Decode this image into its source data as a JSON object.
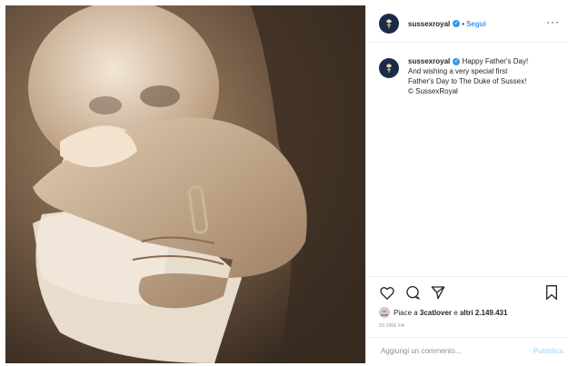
{
  "post": {
    "username": "sussexroyal",
    "follow_label": "Segui",
    "separator": "•",
    "more_icon": "more-dots-icon",
    "caption": {
      "username": "sussexroyal",
      "line1": "Happy Father's Day!",
      "line2": "And wishing a very special first",
      "line3": "Father's Day to The Duke of Sussex!",
      "line4": "© SussexRoyal"
    },
    "actions": {
      "icons": [
        "heart-icon",
        "comment-icon",
        "share-icon",
        "bookmark-icon"
      ]
    },
    "likes": {
      "prefix": "Piace a ",
      "user": "3catlover",
      "middle": " e ",
      "others": "altri 2.149.431",
      "avatar_text": "I ♥ CATS"
    },
    "time": "20 ORE FA",
    "comment": {
      "placeholder": "Aggiungi un commento...",
      "publish_label": "Pubblica"
    }
  },
  "colors": {
    "accent": "#3897f0",
    "avatar_bg": "#1d2b4a",
    "photo_tone": "#8a6e52"
  }
}
